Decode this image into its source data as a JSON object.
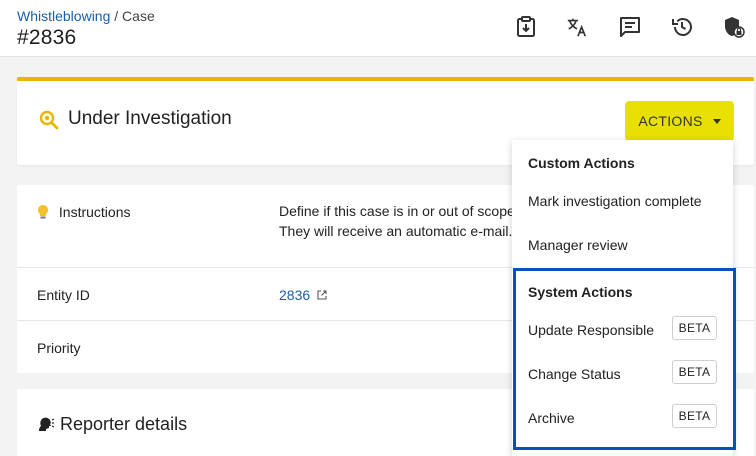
{
  "breadcrumb": {
    "parent": "Whistleblowing",
    "separator": " / ",
    "current": "Case"
  },
  "case": {
    "title": "#2836"
  },
  "toolbar": {
    "icons": [
      "download-form-icon",
      "translate-icon",
      "comment-icon",
      "history-icon",
      "shield-lock-icon"
    ]
  },
  "status": {
    "label": "Under Investigation",
    "accent": "#e6b800"
  },
  "actions": {
    "label": "ACTIONS",
    "color": "#e8e000"
  },
  "instructions": {
    "label": "Instructions",
    "text_line1": "Define if this case is in or out of scope",
    "text_line2": "They will receive an automatic e-mail."
  },
  "entity": {
    "label": "Entity ID",
    "value": "2836"
  },
  "priority": {
    "label": "Priority",
    "value": ""
  },
  "reporter": {
    "label": "Reporter details"
  },
  "menu": {
    "custom_heading": "Custom Actions",
    "custom_items": [
      {
        "label": "Mark investigation complete"
      },
      {
        "label": "Manager review"
      }
    ],
    "system_heading": "System Actions",
    "system_items": [
      {
        "label": "Update Responsible",
        "badge": "BETA"
      },
      {
        "label": "Change Status",
        "badge": "BETA"
      },
      {
        "label": "Archive",
        "badge": "BETA"
      }
    ],
    "highlight_color": "#0a4fc2"
  }
}
